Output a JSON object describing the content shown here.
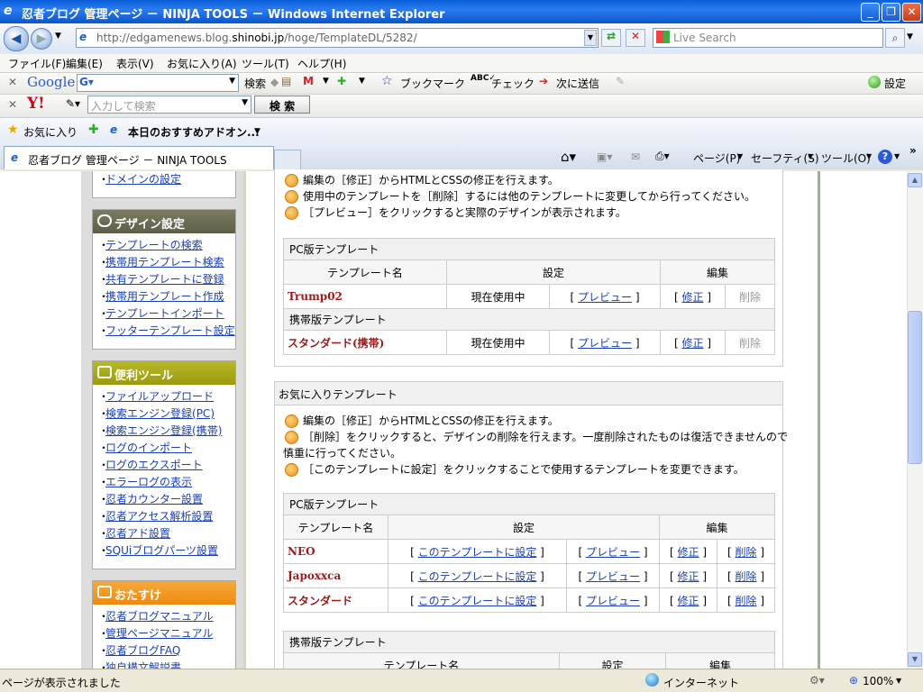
{
  "window": {
    "title": "忍者ブログ 管理ページ － NINJA TOOLS － Windows Internet Explorer"
  },
  "nav": {
    "url_prefix": "http://edgamenews.blog.",
    "url_host": "shinobi.jp",
    "url_path": "/hoge/TemplateDL/5282/",
    "search_placeholder": "Live Search"
  },
  "menu": [
    "ファイル(F)",
    "編集(E)",
    "表示(V)",
    "お気に入り(A)",
    "ツール(T)",
    "ヘルプ(H)"
  ],
  "google_bar": {
    "logo": "Google",
    "search": "検索",
    "bookmark": "ブックマーク",
    "check": "チェック",
    "send": "次に送信",
    "settings": "設定"
  },
  "yahoo_bar": {
    "logo": "Y!",
    "placeholder": "入力して検索",
    "search_button": "検 索"
  },
  "fav_bar": {
    "favorites": "お気に入り",
    "addon": "本日のおすすめアドオン..."
  },
  "tab": {
    "title": "忍者ブログ 管理ページ － NINJA TOOLS"
  },
  "cmdbar": {
    "page": "ページ(P)",
    "safety": "セーフティ(S)",
    "tools": "ツール(O)"
  },
  "sidebar": {
    "domain_link": "ドメインの設定",
    "design": {
      "title": "デザイン設定",
      "items": [
        "テンプレートの検索",
        "携帯用テンプレート検索",
        "共有テンプレートに登録",
        "携帯用テンプレート作成",
        "テンプレートインポート",
        "フッターテンプレート設定"
      ]
    },
    "tools": {
      "title": "便利ツール",
      "items": [
        "ファイルアップロード",
        "検索エンジン登録(PC)",
        "検索エンジン登録(携帯)",
        "ログのインポート",
        "ログのエクスポート",
        "エラーログの表示",
        "忍者カウンター設置",
        "忍者アクセス解析設置",
        "忍者アド設置",
        "SQUiブログパーツ設置"
      ]
    },
    "recommend": {
      "title": "おたすけ",
      "items": [
        "忍者ブログマニュアル",
        "管理ページマニュアル",
        "忍者ブログFAQ",
        "独自構文解説書"
      ]
    }
  },
  "used": {
    "notes": [
      "編集の［修正］からHTMLとCSSの修正を行えます。",
      "使用中のテンプレートを［削除］するには他のテンプレートに変更してから行ってください。",
      "［プレビュー］をクリックすると実際のデザインが表示されます。"
    ],
    "pc_label": "PC版テンプレート",
    "col_name": "テンプレート名",
    "col_setting": "設定",
    "col_edit": "編集",
    "pc_row": {
      "name": "Trump02",
      "status": "現在使用中",
      "preview": "プレビュー",
      "edit": "修正",
      "delete": "削除"
    },
    "mobile_label": "携帯版テンプレート",
    "mobile_row": {
      "name": "スタンダード(携帯)",
      "status": "現在使用中",
      "preview": "プレビュー",
      "edit": "修正",
      "delete": "削除"
    }
  },
  "fav": {
    "title": "お気に入りテンプレート",
    "notes": [
      "編集の［修正］からHTMLとCSSの修正を行えます。",
      "［削除］をクリックすると、デザインの削除を行えます。一度削除されたものは復活できませんので",
      "慎重に行ってください。",
      "［このテンプレートに設定］をクリックすることで使用するテンプレートを変更できます。"
    ],
    "pc_label": "PC版テンプレート",
    "col_name": "テンプレート名",
    "col_setting": "設定",
    "col_edit": "編集",
    "set_label": "このテンプレートに設定",
    "preview": "プレビュー",
    "edit": "修正",
    "delete": "削除",
    "rows": [
      "NEO",
      "Japoxxca",
      "スタンダード"
    ],
    "mobile_label": "携帯版テンプレート"
  },
  "status": {
    "text": "ページが表示されました",
    "zone": "インターネット",
    "zoom": "100%"
  }
}
